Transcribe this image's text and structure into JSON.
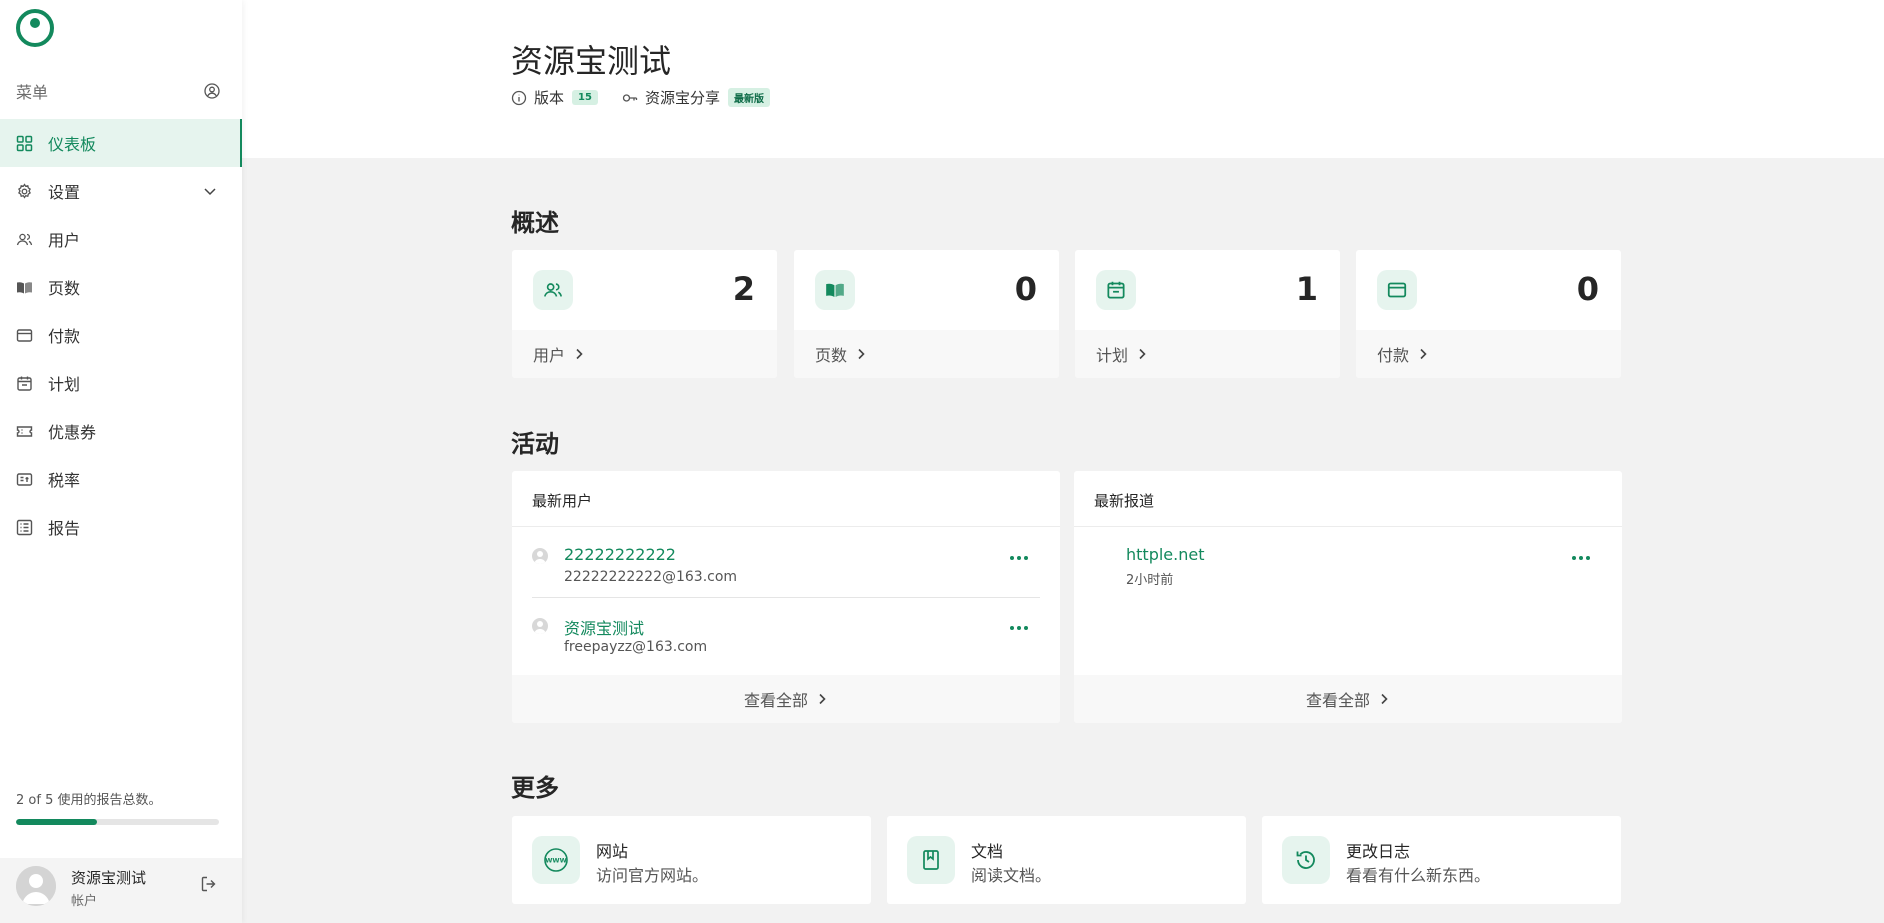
{
  "sidebar": {
    "menu_label": "菜单",
    "items": [
      {
        "label": "仪表板",
        "icon": "grid-icon",
        "active": true
      },
      {
        "label": "设置",
        "icon": "gear-icon"
      },
      {
        "label": "用户",
        "icon": "users-icon"
      },
      {
        "label": "页数",
        "icon": "book-icon"
      },
      {
        "label": "付款",
        "icon": "credit-card-icon"
      },
      {
        "label": "计划",
        "icon": "calendar-icon"
      },
      {
        "label": "优惠券",
        "icon": "ticket-icon"
      },
      {
        "label": "税率",
        "icon": "tax-icon"
      },
      {
        "label": "报告",
        "icon": "list-icon"
      }
    ],
    "usage": {
      "text": "2 of 5 使用的报告总数。",
      "used": 2,
      "total": 5
    },
    "account": {
      "name": "资源宝测试",
      "subtitle": "帐户"
    }
  },
  "header": {
    "title": "资源宝测试",
    "version_label": "版本",
    "version_badge": "15",
    "share_label": "资源宝分享",
    "share_badge": "最新版"
  },
  "overview": {
    "title": "概述",
    "stats": [
      {
        "label": "用户",
        "value": "2",
        "icon": "users-icon"
      },
      {
        "label": "页数",
        "value": "0",
        "icon": "book-icon"
      },
      {
        "label": "计划",
        "value": "1",
        "icon": "calendar-icon"
      },
      {
        "label": "付款",
        "value": "0",
        "icon": "credit-card-icon"
      }
    ]
  },
  "activity": {
    "title": "活动",
    "latest_users": {
      "title": "最新用户",
      "rows": [
        {
          "name": "22222222222",
          "email": "22222222222@163.com"
        },
        {
          "name": "资源宝测试",
          "email": "freepayzz@163.com"
        }
      ],
      "view_all": "查看全部"
    },
    "latest_reports": {
      "title": "最新报道",
      "rows": [
        {
          "name": "httple.net",
          "time": "2小时前"
        }
      ],
      "view_all": "查看全部"
    }
  },
  "more": {
    "title": "更多",
    "cards": [
      {
        "title": "网站",
        "desc": "访问官方网站。",
        "icon": "www-icon"
      },
      {
        "title": "文档",
        "desc": "阅读文档。",
        "icon": "document-icon"
      },
      {
        "title": "更改日志",
        "desc": "看看有什么新东西。",
        "icon": "history-icon"
      }
    ]
  },
  "colors": {
    "accent": "#13895d",
    "accent_light": "#e6f4ee",
    "background": "#f2f2f2"
  }
}
